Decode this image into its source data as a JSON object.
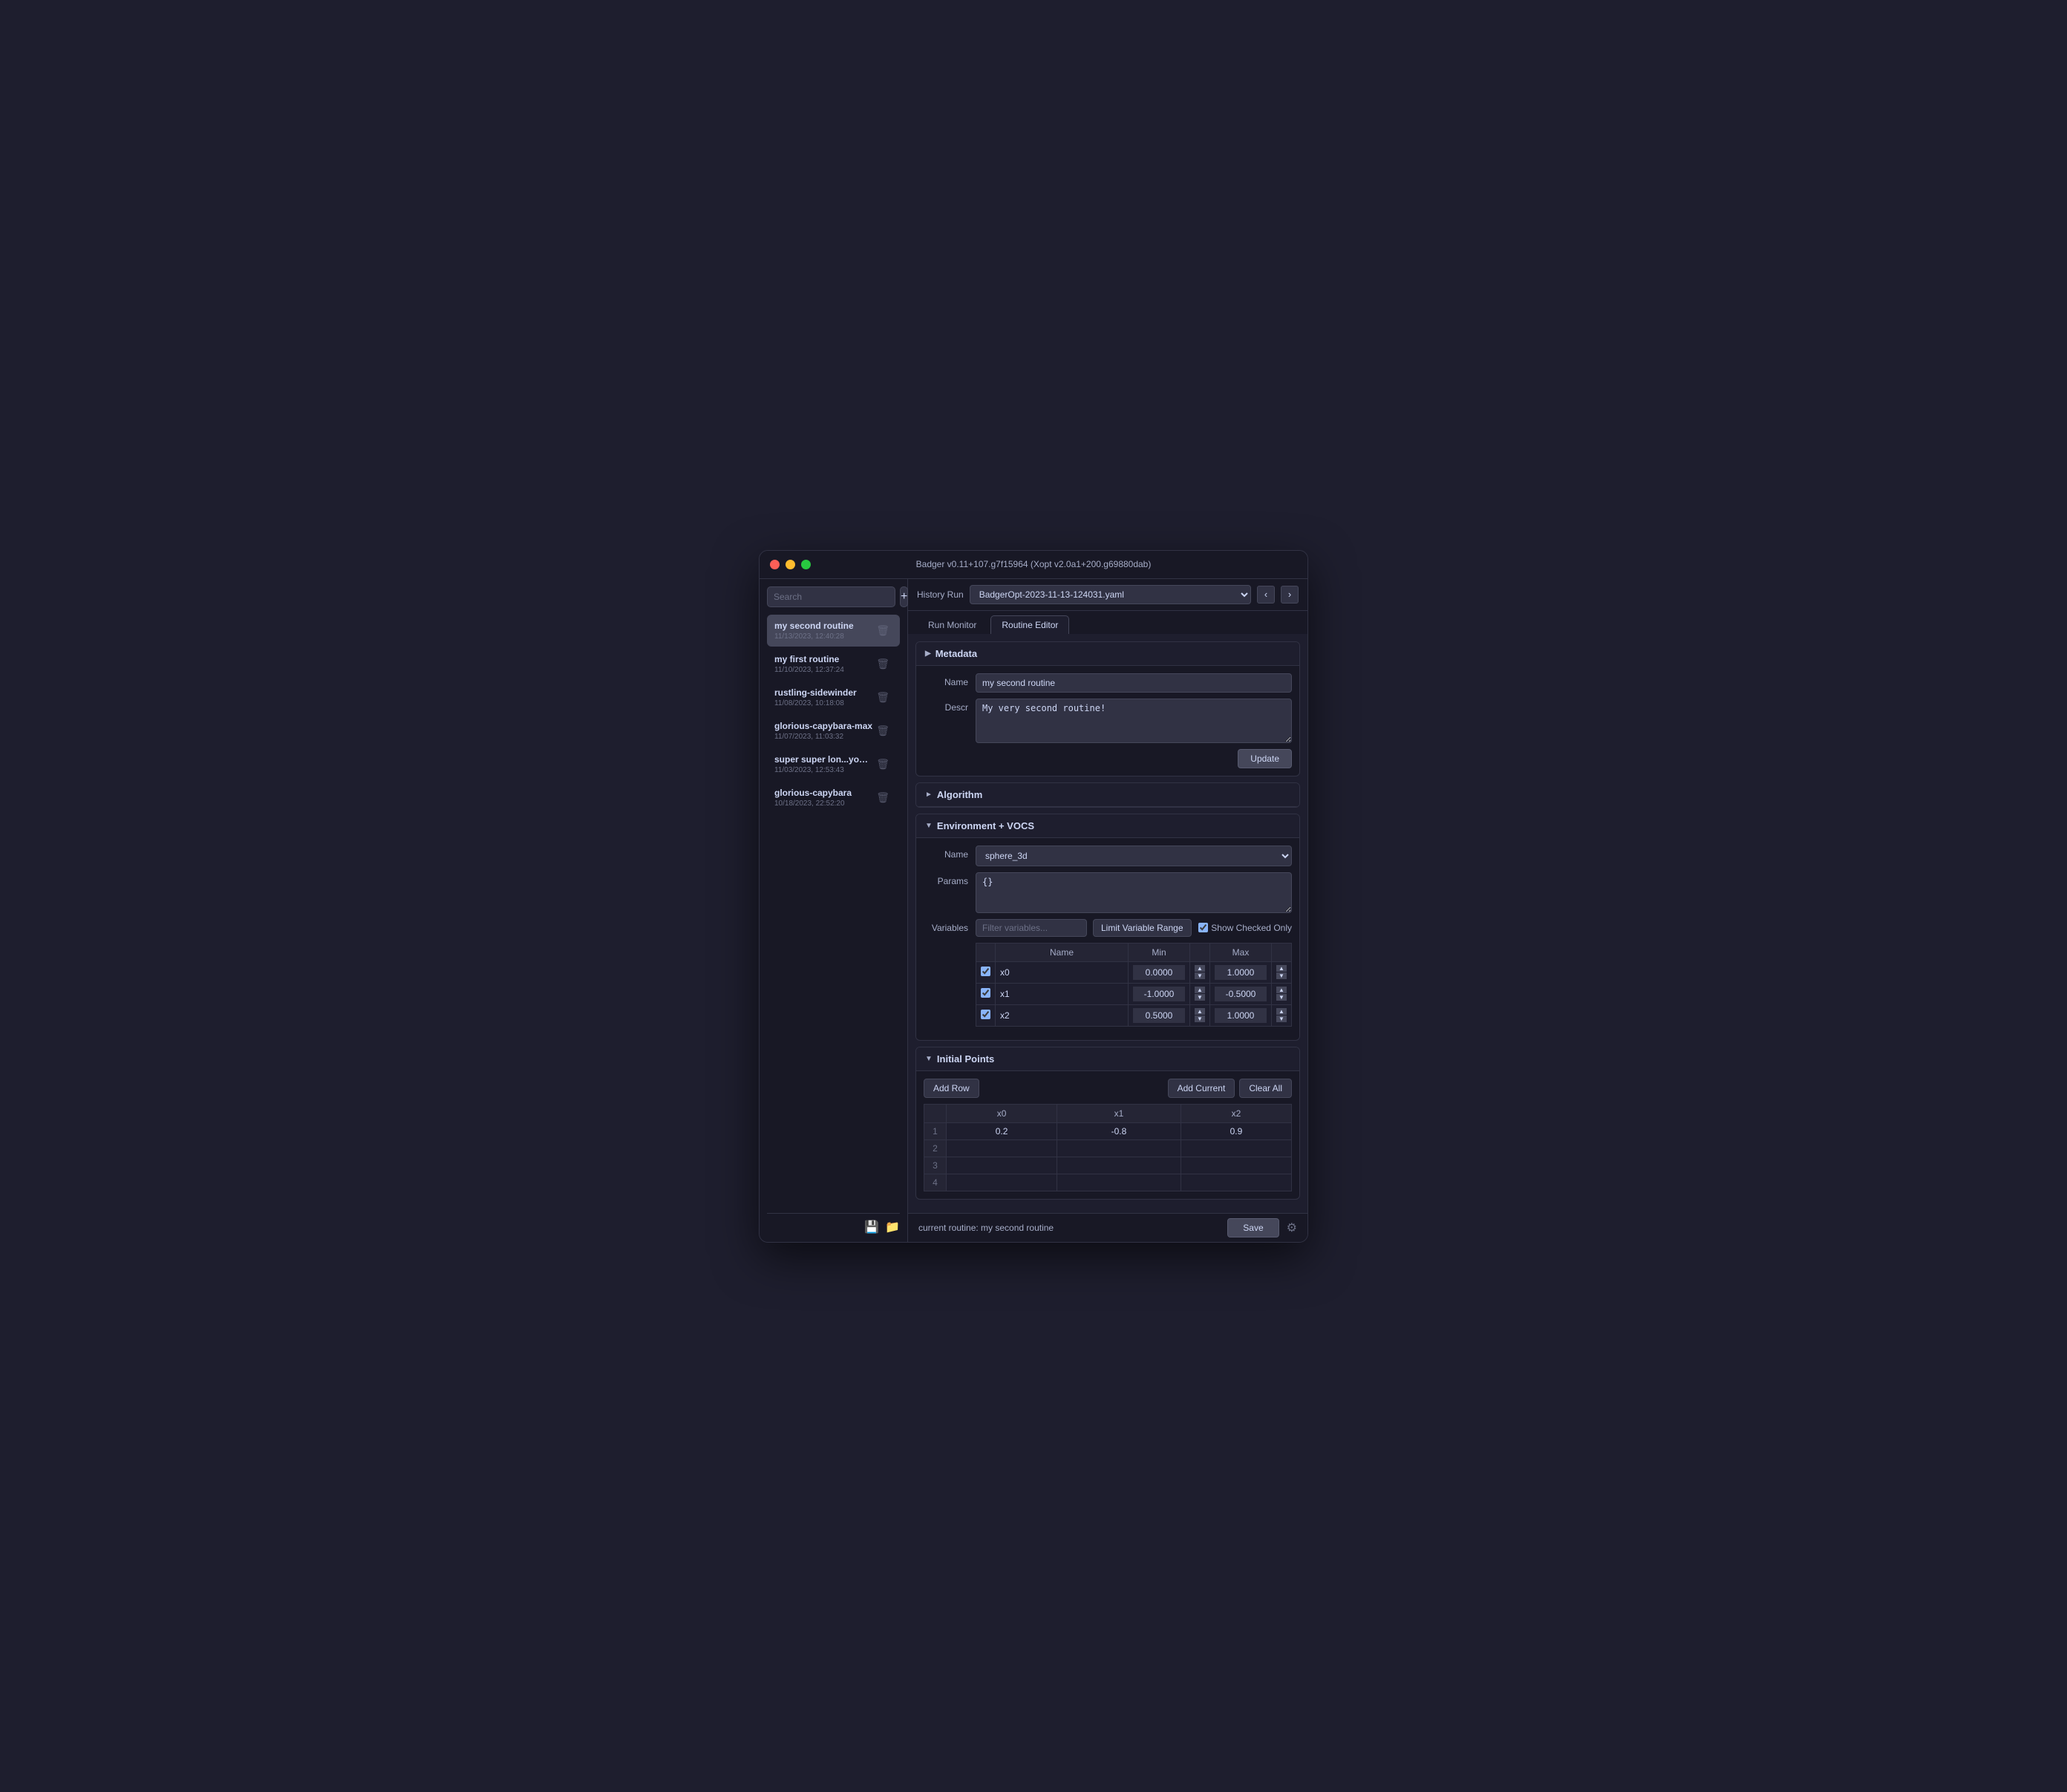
{
  "app": {
    "title": "Badger v0.11+107.g7f15964 (Xopt v2.0a1+200.g69880dab)"
  },
  "history": {
    "label": "History Run",
    "value": "BadgerOpt-2023-11-13-124031.yaml"
  },
  "tabs": [
    {
      "id": "run-monitor",
      "label": "Run Monitor",
      "active": false
    },
    {
      "id": "routine-editor",
      "label": "Routine Editor",
      "active": true
    }
  ],
  "sidebar": {
    "search_placeholder": "Search",
    "add_label": "+",
    "routines": [
      {
        "name": "my second routine",
        "date": "11/13/2023, 12:40:28",
        "active": true
      },
      {
        "name": "my first routine",
        "date": "11/10/2023, 12:37:24",
        "active": false
      },
      {
        "name": "rustling-sidewinder",
        "date": "11/08/2023, 10:18:08",
        "active": false
      },
      {
        "name": "glorious-capybara-max",
        "date": "11/07/2023, 11:03:32",
        "active": false
      },
      {
        "name": "super super lon...you know that!",
        "date": "11/03/2023, 12:53:43",
        "active": false
      },
      {
        "name": "glorious-capybara",
        "date": "10/18/2023, 22:52:20",
        "active": false
      }
    ]
  },
  "metadata": {
    "section_label": "Metadata",
    "name_label": "Name",
    "name_value": "my second routine",
    "descr_label": "Descr",
    "descr_value": "My very second routine!",
    "update_label": "Update"
  },
  "algorithm": {
    "section_label": "Algorithm"
  },
  "environment": {
    "section_label": "Environment + VOCS",
    "name_label": "Name",
    "name_value": "sphere_3d",
    "params_label": "Params",
    "params_value": "{}",
    "variables_label": "Variables",
    "filter_placeholder": "Filter variables...",
    "limit_btn_label": "Limit Variable Range",
    "show_checked_label": "Show Checked Only",
    "variables": [
      {
        "name": "x0",
        "checked": true,
        "min": "0.0000",
        "max": "1.0000"
      },
      {
        "name": "x1",
        "checked": true,
        "min": "-1.0000",
        "max": "-0.5000"
      },
      {
        "name": "x2",
        "checked": true,
        "min": "0.5000",
        "max": "1.0000"
      }
    ]
  },
  "initial_points": {
    "section_label": "Initial Points",
    "add_row_label": "Add Row",
    "add_current_label": "Add Current",
    "clear_all_label": "Clear All",
    "columns": [
      "x0",
      "x1",
      "x2"
    ],
    "rows": [
      {
        "id": 1,
        "x0": "0.2",
        "x1": "-0.8",
        "x2": "0.9"
      },
      {
        "id": 2,
        "x0": "",
        "x1": "",
        "x2": ""
      },
      {
        "id": 3,
        "x0": "",
        "x1": "",
        "x2": ""
      },
      {
        "id": 4,
        "x0": "",
        "x1": "",
        "x2": ""
      }
    ]
  },
  "bottom": {
    "current_routine_label": "current routine: my second routine",
    "save_label": "Save"
  }
}
